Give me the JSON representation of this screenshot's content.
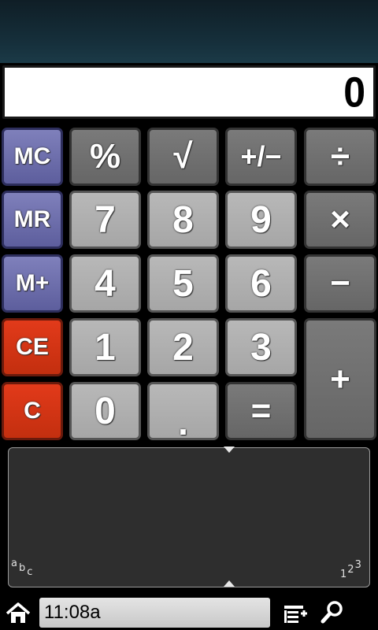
{
  "display": {
    "value": "0"
  },
  "keys": {
    "mc": "MC",
    "mr": "MR",
    "mplus": "M+",
    "ce": "CE",
    "c": "C",
    "percent": "%",
    "sqrt": "√",
    "plusminus": "+/−",
    "divide": "÷",
    "multiply": "×",
    "minus": "−",
    "plus": "+",
    "equals": "=",
    "decimal": ".",
    "d7": "7",
    "d8": "8",
    "d9": "9",
    "d4": "4",
    "d5": "5",
    "d6": "6",
    "d1": "1",
    "d2": "2",
    "d3": "3",
    "d0": "0"
  },
  "handwriting": {
    "mode_letters": [
      "a",
      "b",
      "c"
    ],
    "mode_numbers": [
      "1",
      "2",
      "3"
    ]
  },
  "statusbar": {
    "time": "11:08a"
  },
  "icons": [
    "home-icon",
    "task-list-icon",
    "search-icon"
  ],
  "colors": {
    "memory_key": "#6e6fae",
    "clear_key": "#d2331a",
    "operator_key": "#6e6e6e",
    "digit_key": "#b0b0b0"
  }
}
